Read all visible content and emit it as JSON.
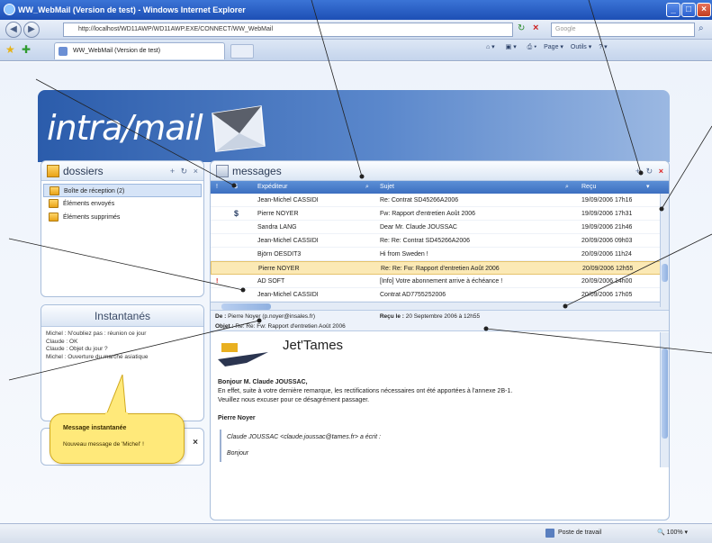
{
  "window": {
    "title": "WW_WebMail (Version de test) - Windows Internet Explorer",
    "url": "http://localhost/WD11AWP/WD11AWP.EXE/CONNECT/WW_WebMail",
    "search_placeholder": "Google",
    "tab_label": "WW_WebMail (Version de test)",
    "toolbar": {
      "page": "Page",
      "tools": "Outils"
    }
  },
  "app": {
    "logo": "intra/mail"
  },
  "folders": {
    "title": "dossiers",
    "items": [
      {
        "label": "Boîte de réception (2)",
        "selected": true
      },
      {
        "label": "Éléments envoyés",
        "selected": false
      },
      {
        "label": "Éléments supprimés",
        "selected": false
      }
    ]
  },
  "instant": {
    "title": "Instantanés",
    "lines": [
      "Michel : N'oubliez pas : réunion ce jour",
      "Claude : OK",
      "Claude : Objet du jour ?",
      "Michel : Ouverture du marché asiatique"
    ]
  },
  "notification": {
    "title": "Message instantanée",
    "text": "Nouveau message de 'Michel' !"
  },
  "messages": {
    "title": "messages",
    "columns": {
      "sender": "Expéditeur",
      "subject": "Sujet",
      "received": "Reçu"
    },
    "rows": [
      {
        "urgent": false,
        "money": false,
        "sender": "Jean-Michel CASSIDI",
        "subject": "Re: Contrat SD45266A2006",
        "date": "19/09/2006  17h16",
        "selected": false
      },
      {
        "urgent": false,
        "money": true,
        "sender": "Pierre NOYER",
        "subject": "Fw: Rapport d'entretien Août 2006",
        "date": "19/09/2006  17h31",
        "selected": false
      },
      {
        "urgent": false,
        "money": false,
        "sender": "Sandra LANG",
        "subject": "Dear Mr. Claude JOUSSAC",
        "date": "19/09/2006  21h46",
        "selected": false
      },
      {
        "urgent": false,
        "money": false,
        "sender": "Jean-Michel CASSIDI",
        "subject": "Re: Re: Contrat SD45266A2006",
        "date": "20/09/2006  09h03",
        "selected": false
      },
      {
        "urgent": false,
        "money": false,
        "sender": "Björn OESDIT3",
        "subject": "Hi from Sweden !",
        "date": "20/09/2006  11h24",
        "selected": false
      },
      {
        "urgent": false,
        "money": false,
        "sender": "Pierre NOYER",
        "subject": "Re: Re: Fw: Rapport d'entretien Août 2006",
        "date": "20/09/2006  12h55",
        "selected": true
      },
      {
        "urgent": true,
        "money": false,
        "sender": "AD SOFT",
        "subject": "[Info] Votre abonnement arrive à échéance !",
        "date": "20/09/2006  14h00",
        "selected": false
      },
      {
        "urgent": false,
        "money": false,
        "sender": "Jean-Michel CASSIDI",
        "subject": "Contrat AD7755252006",
        "date": "20/09/2006  17h05",
        "selected": false
      }
    ],
    "symbols": {
      "urgent": "!",
      "money": "$"
    }
  },
  "preview": {
    "from_label": "De :",
    "from": "Pierre Noyer (p.noyer@insales.fr)",
    "subject_label": "Objet :",
    "subject": "Re: Re: Fw: Rapport d'entretien Août 2006",
    "received_label": "Reçu le :",
    "received": "20 Septembre 2006 à 12h55",
    "company": "Jet'Tames",
    "greeting": "Bonjour M. Claude JOUSSAC,",
    "body1": "En effet, suite à votre dernière remarque, les rectifications nécessaires ont été apportées à l'annexe 2B-1.",
    "body2": "Veuillez nous excuser pour ce désagrément passager.",
    "signature": "Pierre Noyer",
    "quote": "Claude JOUSSAC <claude.joussac@tames.fr> a écrit :",
    "quote2": "Bonjour"
  },
  "status": {
    "zone": "Poste de travail",
    "zoom": "100%"
  },
  "colors": {
    "banner": "#2b5cab",
    "header_blue": "#3c6fc0",
    "selected_row": "#fbe9b5",
    "urgent": "#d01818",
    "bubble": "#ffe97a"
  }
}
